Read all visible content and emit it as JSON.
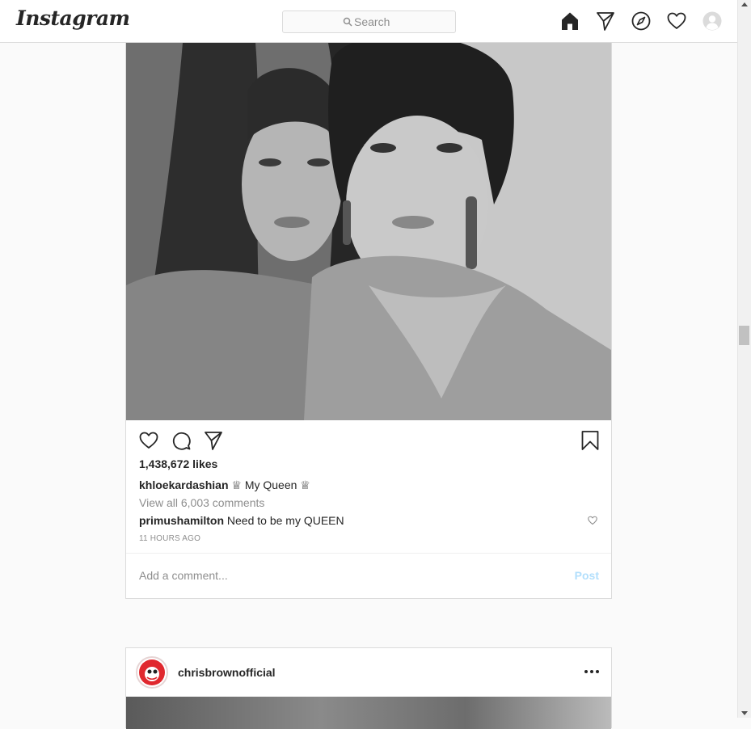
{
  "brand": {
    "logo_text": "Instagram"
  },
  "search": {
    "placeholder": "Search"
  },
  "nav": {
    "icons": [
      "home-icon",
      "direct-icon",
      "explore-icon",
      "activity-heart-icon",
      "profile-avatar"
    ]
  },
  "post": {
    "likes": "1,438,672 likes",
    "caption": {
      "username": "khloekardashian",
      "text": "♕ My Queen ♕"
    },
    "view_all_comments": "View all 6,003 comments",
    "comment": {
      "username": "primushamilton",
      "text": "Need to be my QUEEN"
    },
    "timestamp": "11 HOURS AGO",
    "add_comment": {
      "placeholder": "Add a comment...",
      "post_label": "Post"
    }
  },
  "next_post": {
    "username": "chrisbrownofficial"
  },
  "colors": {
    "link_disabled": "#b2dffc",
    "muted": "#8e8e8e",
    "text": "#262626",
    "border": "#dbdbdb"
  }
}
